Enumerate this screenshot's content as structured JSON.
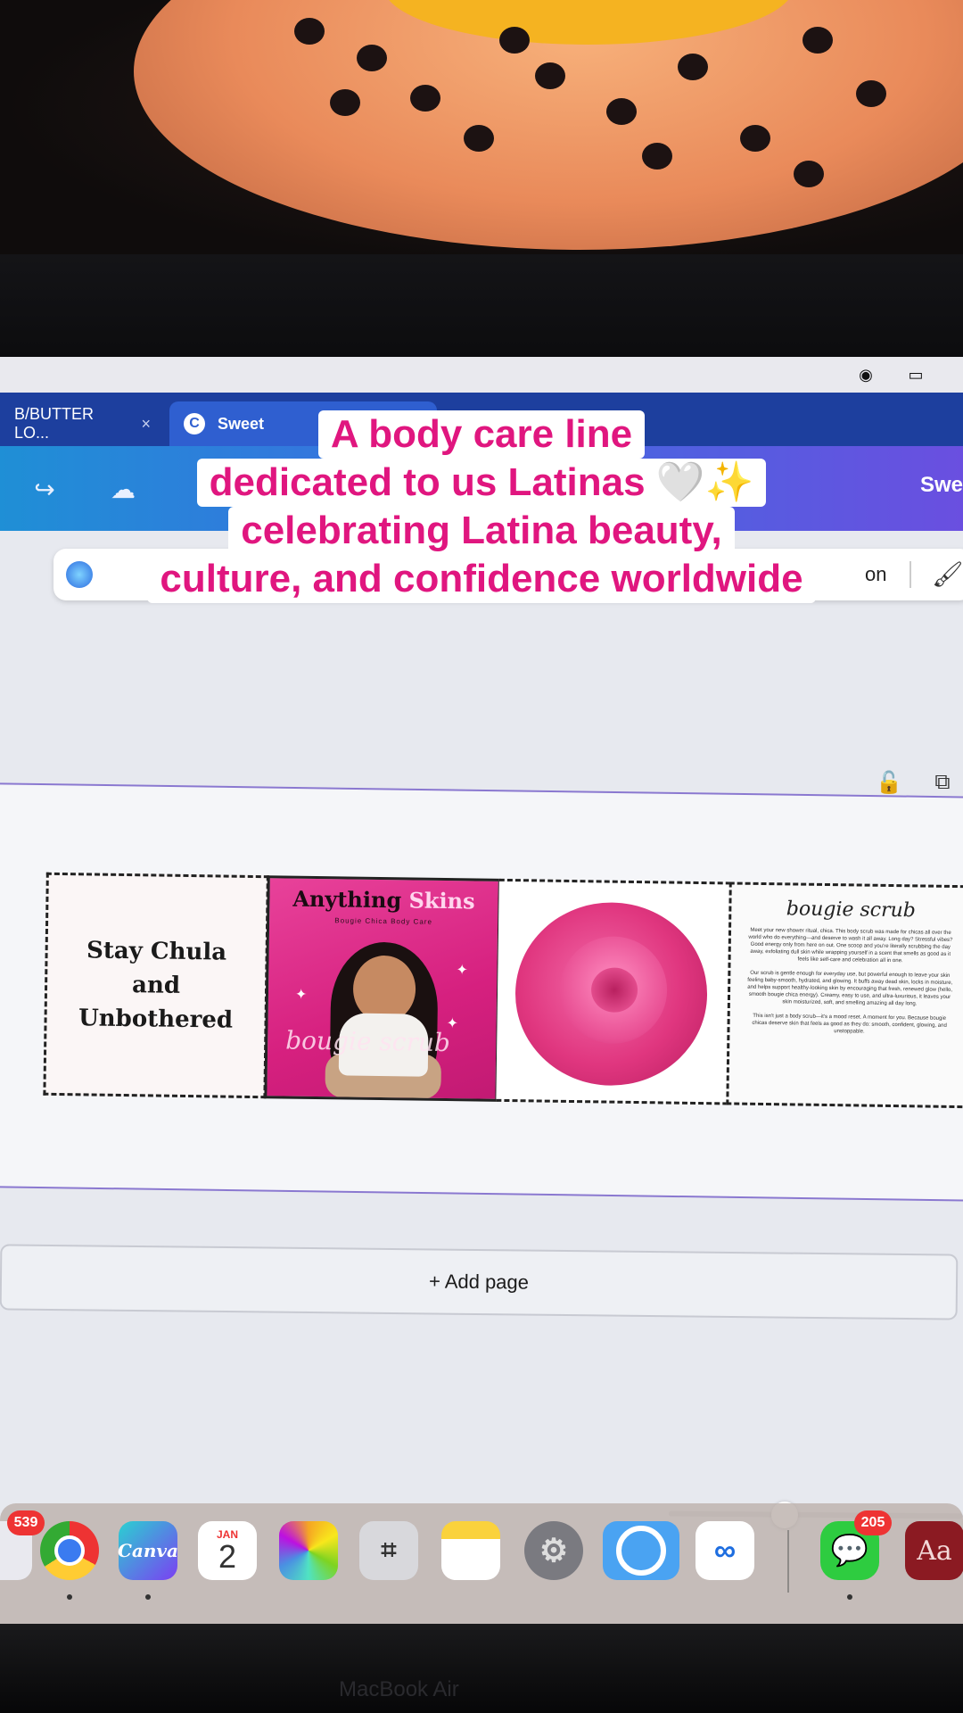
{
  "caption": {
    "lines": [
      "A body care line",
      "dedicated to us Latinas 🤍✨",
      "celebrating Latina beauty,",
      "culture, and confidence worldwide"
    ]
  },
  "browser": {
    "tabs": [
      {
        "label": "B/BUTTER LO...",
        "close": "×"
      },
      {
        "label": "Sweet"
      }
    ],
    "toolbar_right_text": "Swe"
  },
  "context_bar": {
    "text": "on"
  },
  "design": {
    "panel1_text": "Stay Chula\nand\nUnbothered",
    "panel2": {
      "title_a": "Anything ",
      "title_b": "Skins",
      "subtitle": "Bougie Chica Body Care",
      "script": "bougie scrub"
    },
    "panel4": {
      "script_title": "bougie scrub",
      "paragraphs": [
        "Meet your new shower ritual, chica. This body scrub was made for chicas all over the world who do everything—and deserve to wash it all away. Long day? Stressful vibes? Good energy only from here on out. One scoop and you're literally scrubbing the day away, exfoliating dull skin while wrapping yourself in a scent that smells as good as it feels like self-care and celebration all in one.",
        "Our scrub is gentle enough for everyday use, but powerful enough to leave your skin feeling baby-smooth, hydrated, and glowing. It buffs away dead skin, locks in moisture, and helps support healthy-looking skin by encouraging that fresh, renewed glow (hello, smooth bougie chica energy). Creamy, easy to use, and ultra-luxurious, it leaves your skin moisturized, soft, and smelling amazing all day long.",
        "This isn't just a body scrub—it's a mood reset. A moment for you. Because bougie chicas deserve skin that feels as good as they do: smooth, confident, glowing, and unstoppable."
      ]
    }
  },
  "add_page_label": "+ Add page",
  "dock": {
    "mail_badge": "539",
    "canva_label": "Canva",
    "calendar_month": "JAN",
    "calendar_day": "2",
    "messages_badge": "205",
    "dictionary_label": "Aa"
  },
  "laptop_label": "MacBook Air",
  "colors": {
    "caption_pink": "#e0167f",
    "tabbar": "#1d3f9e",
    "accent_purple": "#8a78d0"
  }
}
